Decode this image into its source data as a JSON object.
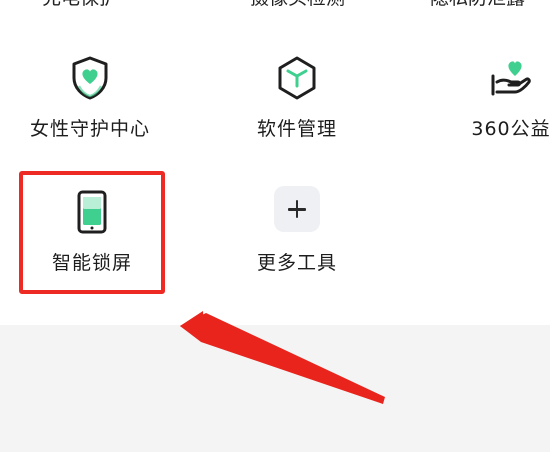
{
  "top_row_cut": {
    "items": [
      "充电保护",
      "摄像头检测",
      "隐私防泄露"
    ]
  },
  "tools": [
    {
      "label": "女性守护中心",
      "icon": "shield-heart-icon"
    },
    {
      "label": "软件管理",
      "icon": "cube-box-icon"
    },
    {
      "label": "360公益",
      "icon": "hand-heart-icon"
    },
    {
      "label": "智能锁屏",
      "icon": "phone-lock-icon"
    },
    {
      "label": "更多工具",
      "icon": "plus-icon"
    }
  ],
  "colors": {
    "accent_green": "#3fcf8e",
    "icon_dark": "#1f1f1f",
    "highlight_red": "#ee2a24",
    "arrow_red": "#e8241d"
  }
}
